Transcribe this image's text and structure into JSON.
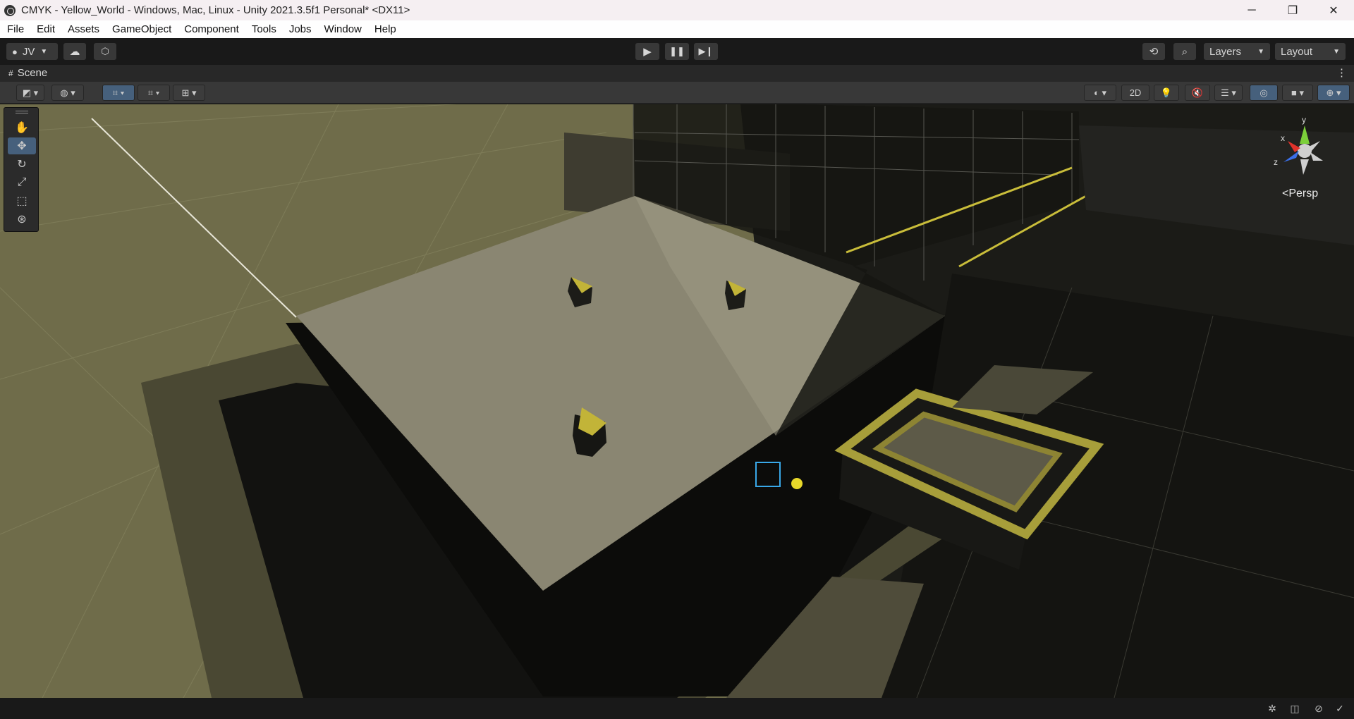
{
  "window": {
    "title": "CMYK - Yellow_World - Windows, Mac, Linux - Unity 2021.3.5f1 Personal* <DX11>",
    "controls": {
      "minimize": "─",
      "maximize": "❐",
      "close": "✕"
    }
  },
  "menu": {
    "items": [
      "File",
      "Edit",
      "Assets",
      "GameObject",
      "Component",
      "Tools",
      "Jobs",
      "Window",
      "Help"
    ]
  },
  "toolbar": {
    "account_label": "JV",
    "layers_label": "Layers",
    "layout_label": "Layout"
  },
  "scene_tab": {
    "label": "Scene"
  },
  "scene_toolbar": {
    "mode_2d_label": "2D"
  },
  "gizmo": {
    "projection_label": "Persp",
    "axis_x": "x",
    "axis_y": "y",
    "axis_z": "z",
    "colors": {
      "x": "#e0322b",
      "y": "#7ccf3a",
      "z": "#3a6fe8"
    }
  },
  "scene_colors": {
    "ground": "#6f6c4a",
    "platform_top": "#8a8672",
    "yellow_accent": "#c9bd3a"
  }
}
